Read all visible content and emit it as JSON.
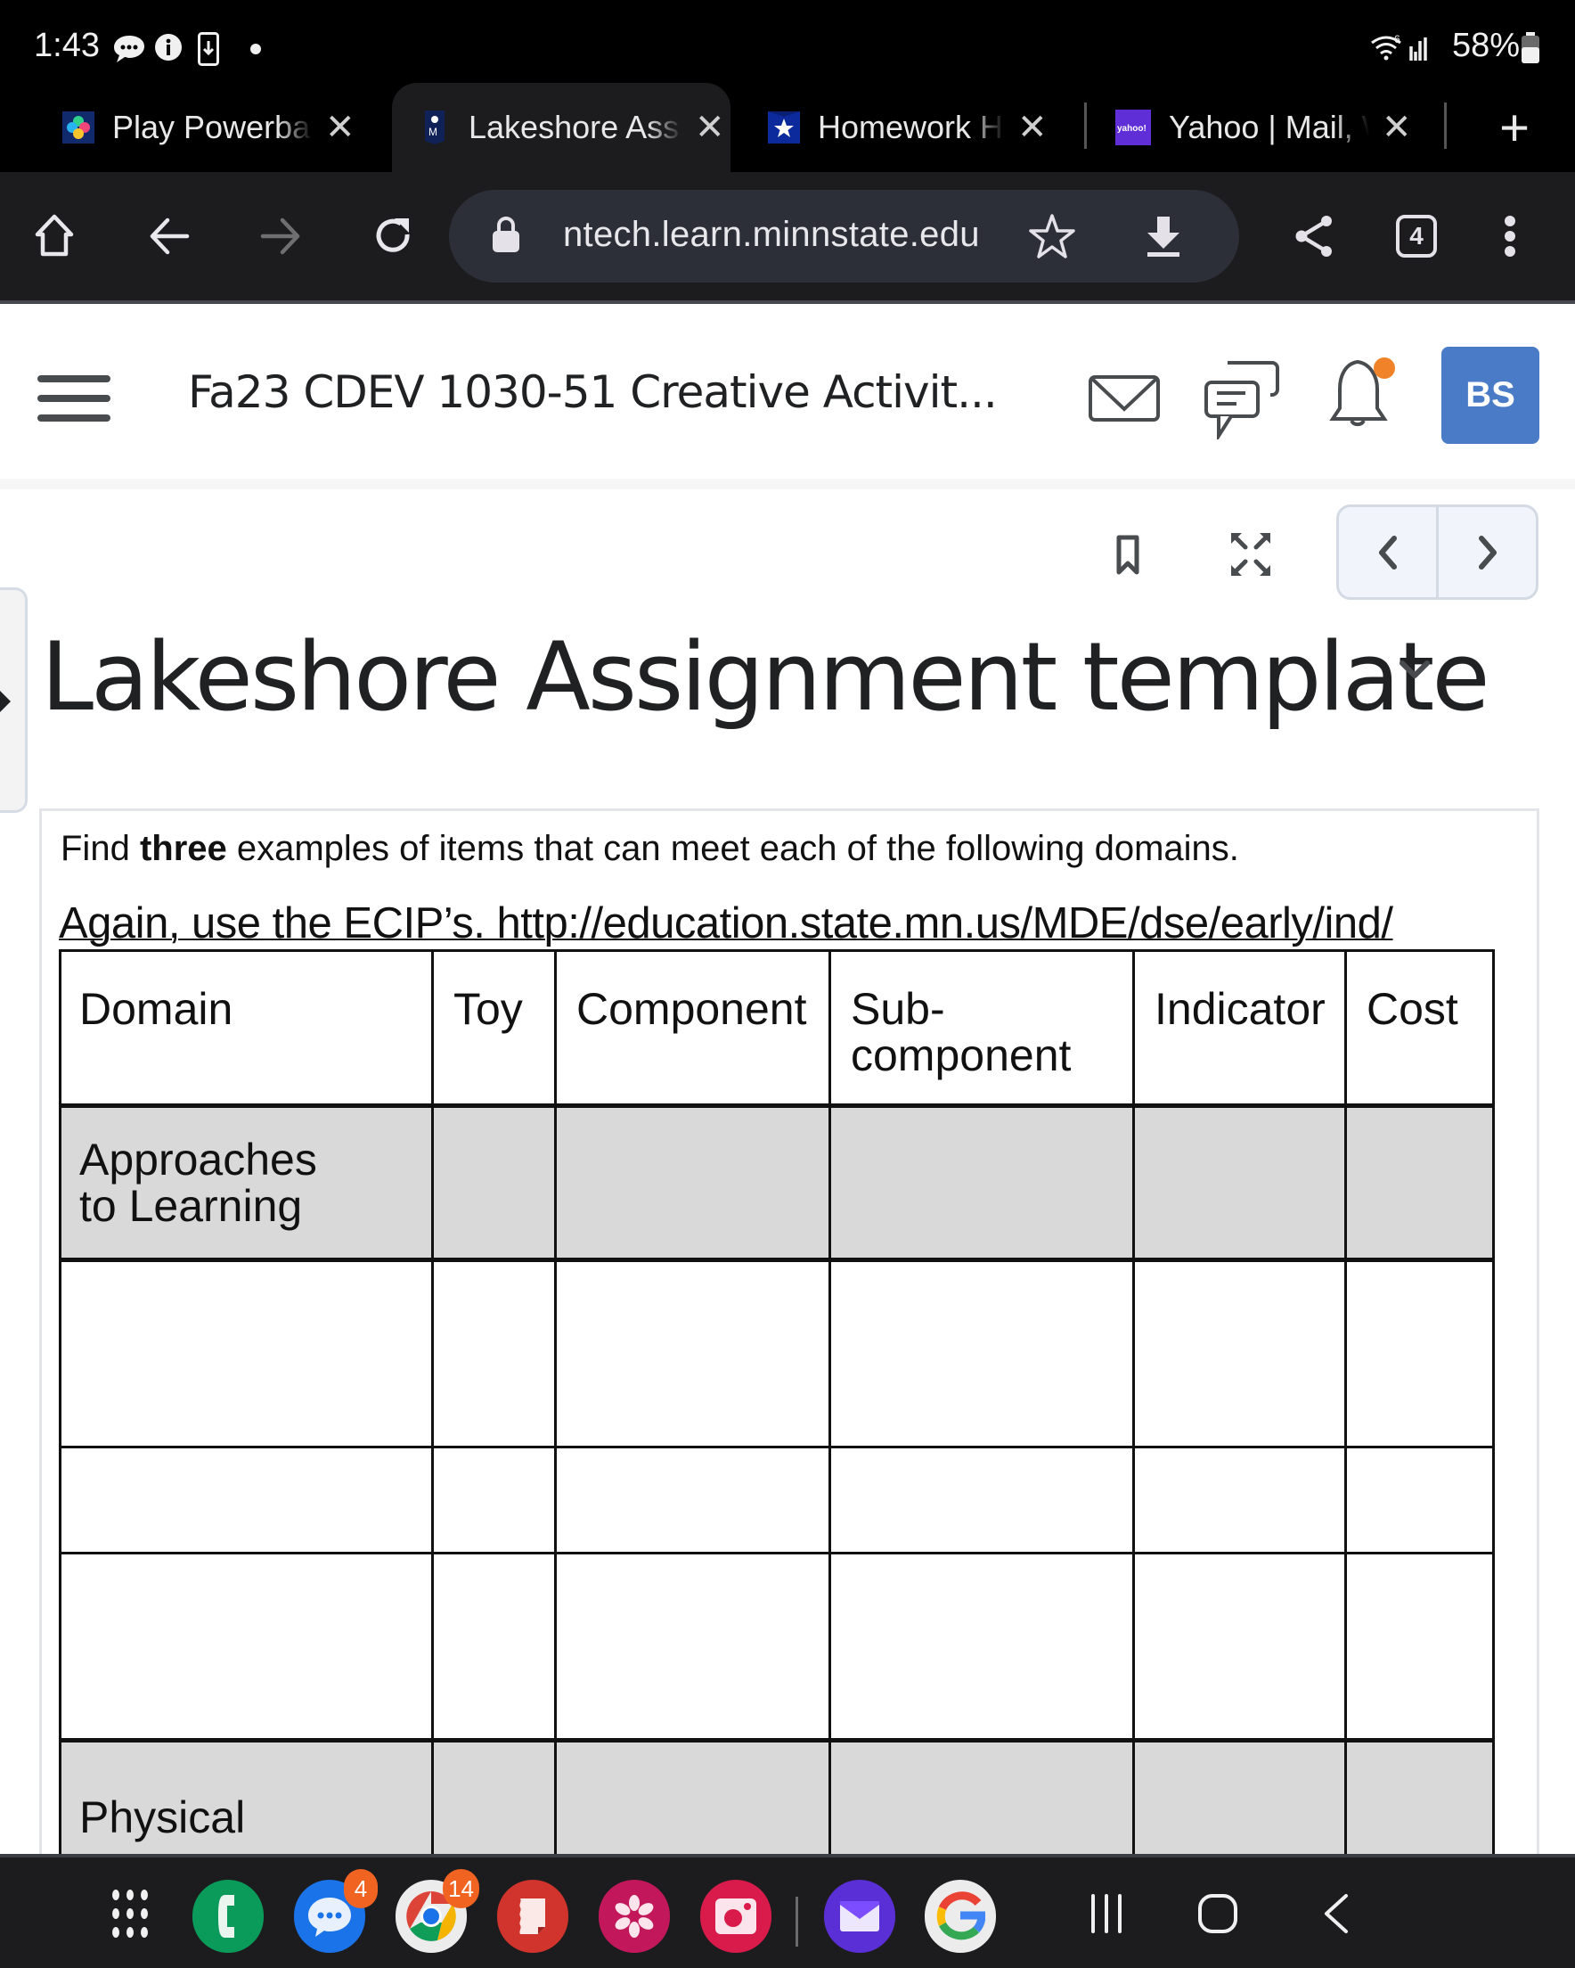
{
  "status_bar": {
    "time": "1:43",
    "left_icons": [
      "messages-icon",
      "info-icon",
      "download-phone-icon",
      "dot-icon"
    ],
    "network": "wifi-6-icon",
    "battery_percent": "58%"
  },
  "browser": {
    "tabs": [
      {
        "title": "Play Powerball",
        "favicon": "powerball-favicon",
        "active": false
      },
      {
        "title": "Lakeshore Ass",
        "favicon": "minnstate-favicon",
        "active": true
      },
      {
        "title": "Homework He",
        "favicon": "star-favicon",
        "active": false
      },
      {
        "title": "Yahoo | Mail, W",
        "favicon": "yahoo-favicon",
        "active": false
      }
    ],
    "tab_close_glyph": "✕",
    "new_tab_glyph": "+",
    "url": "ntech.learn.minnstate.edu",
    "tab_count": "4",
    "yahoo_favicon_text": "yahoo!"
  },
  "course_header": {
    "title": "Fa23 CDEV 1030-51 Creative Activit...",
    "avatar_initials": "BS",
    "notification_dot_color": "#f0832a",
    "avatar_color": "#4a7bc6"
  },
  "page": {
    "title": "Lakeshore Assignment template",
    "instructions": {
      "line1_before": "Find ",
      "line1_bold": "three",
      "line1_after": " examples of items that can meet each of the following domains.",
      "line2_prefix": "Again, use the ECIP’s. ",
      "line2_link": "http://education.state.mn.us/MDE/dse/early/ind/"
    },
    "table": {
      "headers": [
        "Domain",
        "Toy",
        "Component",
        "Sub-component",
        "Indicator",
        "Cost"
      ],
      "rows": [
        {
          "domain": "Approaches to Learning",
          "shaded": true,
          "cells": [
            "",
            "",
            "",
            "",
            ""
          ]
        },
        {
          "domain": "",
          "shaded": false,
          "cells": [
            "",
            "",
            "",
            "",
            ""
          ]
        },
        {
          "domain": "",
          "shaded": false,
          "cells": [
            "",
            "",
            "",
            "",
            ""
          ]
        },
        {
          "domain": "",
          "shaded": false,
          "cells": [
            "",
            "",
            "",
            "",
            ""
          ]
        },
        {
          "domain": "Physical",
          "shaded": true,
          "cells": [
            "",
            "",
            "",
            "",
            ""
          ]
        }
      ]
    }
  },
  "dock": {
    "apps": [
      {
        "name": "phone",
        "badge": ""
      },
      {
        "name": "messages",
        "badge": "4"
      },
      {
        "name": "chrome",
        "badge": "14"
      },
      {
        "name": "notes",
        "badge": ""
      },
      {
        "name": "gallery",
        "badge": ""
      },
      {
        "name": "camera",
        "badge": ""
      },
      {
        "name": "email",
        "badge": ""
      },
      {
        "name": "google",
        "badge": ""
      }
    ]
  }
}
